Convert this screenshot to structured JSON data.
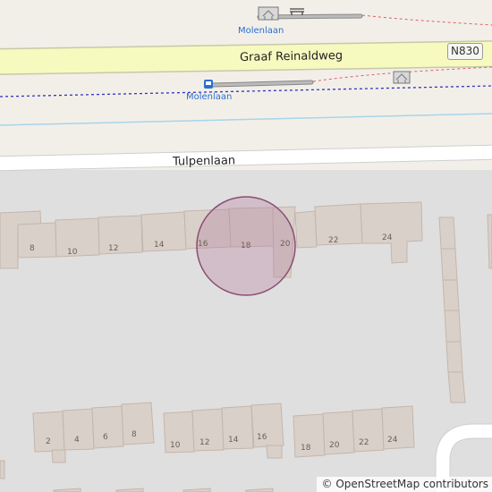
{
  "map": {
    "roads": {
      "main_road": "Graaf Reinaldweg",
      "route_ref": "N830",
      "side_street": "Tulpenlaan"
    },
    "bus_stops": {
      "north": "Molenlaan",
      "south": "Molenlaan"
    },
    "house_numbers_top": [
      "8",
      "10",
      "12",
      "14",
      "16",
      "18",
      "20",
      "22",
      "24"
    ],
    "house_numbers_bottom_left": [
      "2",
      "4",
      "6",
      "8"
    ],
    "house_numbers_bottom_mid": [
      "10",
      "12",
      "14",
      "16"
    ],
    "house_numbers_bottom_right": [
      "18",
      "20",
      "22",
      "24"
    ],
    "highlight_color": "#b482a0",
    "attribution": "© OpenStreetMap contributors"
  }
}
